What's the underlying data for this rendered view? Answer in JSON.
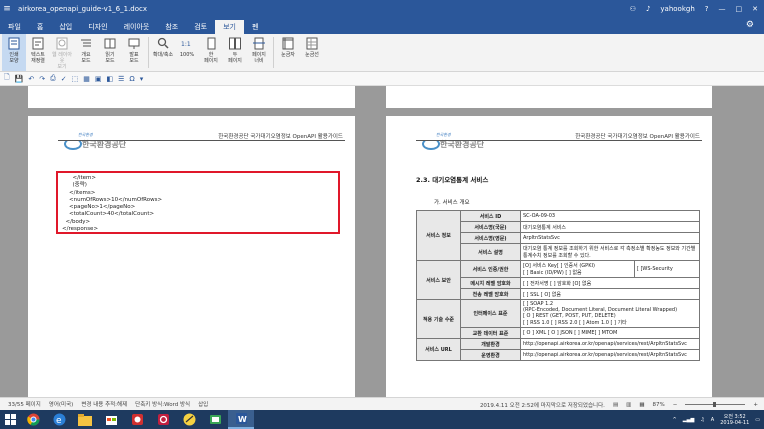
{
  "titlebar": {
    "title": "airkorea_openapi_guide-v1_6_1.docx",
    "user": "yahookgh",
    "help": "?",
    "minimize": "—",
    "maximize": "□",
    "close": "✕"
  },
  "tabs": [
    "파일",
    "홈",
    "삽입",
    "디자인",
    "레이아웃",
    "참조",
    "검토",
    "보기",
    "펜"
  ],
  "active_tab": "보기",
  "ribbon": [
    {
      "l1": "인쇄",
      "l2": "모양"
    },
    {
      "l1": "텍스트",
      "l2": "재정렬"
    },
    {
      "l1": "웹 레이아웃",
      "l2": "보기"
    },
    {
      "l1": "개요",
      "l2": "모드"
    },
    {
      "l1": "읽기",
      "l2": "모드"
    },
    {
      "l1": "발표",
      "l2": "모드"
    },
    {
      "l1": "확대/축소",
      "l2": ""
    },
    {
      "l1": "100%",
      "l2": ""
    },
    {
      "l1": "한",
      "l2": "페이지"
    },
    {
      "l1": "두",
      "l2": "페이지"
    },
    {
      "l1": "페이지",
      "l2": "너비"
    },
    {
      "l1": "눈금자",
      "l2": ""
    },
    {
      "l1": "눈금선",
      "l2": ""
    }
  ],
  "page_header": {
    "logo_top": "한국환경",
    "logo_text": "한국환경공단",
    "guide": "한국환경공단 국가대기오염정보 OpenAPI 활용가이드"
  },
  "code_lines": [
    "      </item>",
    "      (중략)",
    "    </items>",
    "    <numOfRows>10</numOfRows>",
    "    <pageNo>1</pageNo>",
    "    <totalCount>40</totalCount>",
    "  </body>",
    "</response>"
  ],
  "section": {
    "title": "2.3. 대기오염통계 서비스",
    "subtitle": "가. 서비스 개요"
  },
  "table": {
    "group_info": "서비스 정보",
    "group_security": "서비스 보안",
    "group_standard": "적용 기술 수준",
    "group_url": "서비스 URL",
    "rows": [
      {
        "label": "서비스 ID",
        "value": "SC-OA-09-03"
      },
      {
        "label": "서비스명(국문)",
        "value": "대기오염통계 서비스"
      },
      {
        "label": "서비스명(영문)",
        "value": "ArpltnStatsSvc"
      },
      {
        "label": "서비스 설명",
        "value": "대기오염 통계 정보를 조회하기 위한 서비스로 각 측정소별 확정농도 정보와 기간별 통계수치 정보를 조회할 수 있다."
      },
      {
        "label": "서비스 인증/권한",
        "value": "[O] 서비스 Key[ ] 인증서 (GPKI)",
        "value2": "[ ] Basic (ID/PW) [ ] 없음",
        "extra": "[ ]WS-Security"
      },
      {
        "label": "메시지 레벨 암호화",
        "value": "[ ] 전자서명    [ ] 암호화    [O] 없음"
      },
      {
        "label": "전송 레벨 암호화",
        "value": "[ ] SSL              [ O] 없음"
      },
      {
        "label": "인터페이스 표준",
        "lines": [
          "[ ] SOAP 1.2",
          "(RPC-Encoded, Document Literal, Document Literal Wrapped)",
          "[ O ] REST (GET, POST, PUT, DELETE)",
          "[ ] RSS 1.0 [ ] RSS 2.0 [ ] Atom 1.0 [ ] 기타"
        ]
      },
      {
        "label": "교환 데이터 표준",
        "value": "[ O ] XML          [ O ] JSON          [ ] MIME[ ] MTOM"
      },
      {
        "label": "개발환경",
        "value": "http://openapi.airkorea.or.kr/openapi/services/rest/ArpltnStatsSvc"
      },
      {
        "label": "운영환경",
        "value": "http://openapi.airkorea.or.kr/openapi/services/rest/ArpltnStatsSvc"
      }
    ]
  },
  "statusbar": {
    "page": "33/55 페이지",
    "lang": "영어(미국)",
    "track": "변경 내용 추적:해제",
    "shortcut": "단축키 방식:Word 방식",
    "insert": "삽입",
    "saved": "2019.4.11 오전 2:52에 마지막으로 저장되었습니다.",
    "zoom": "87%"
  },
  "taskbar": {
    "time": "오전 3:52",
    "date": "2019-04-11"
  }
}
